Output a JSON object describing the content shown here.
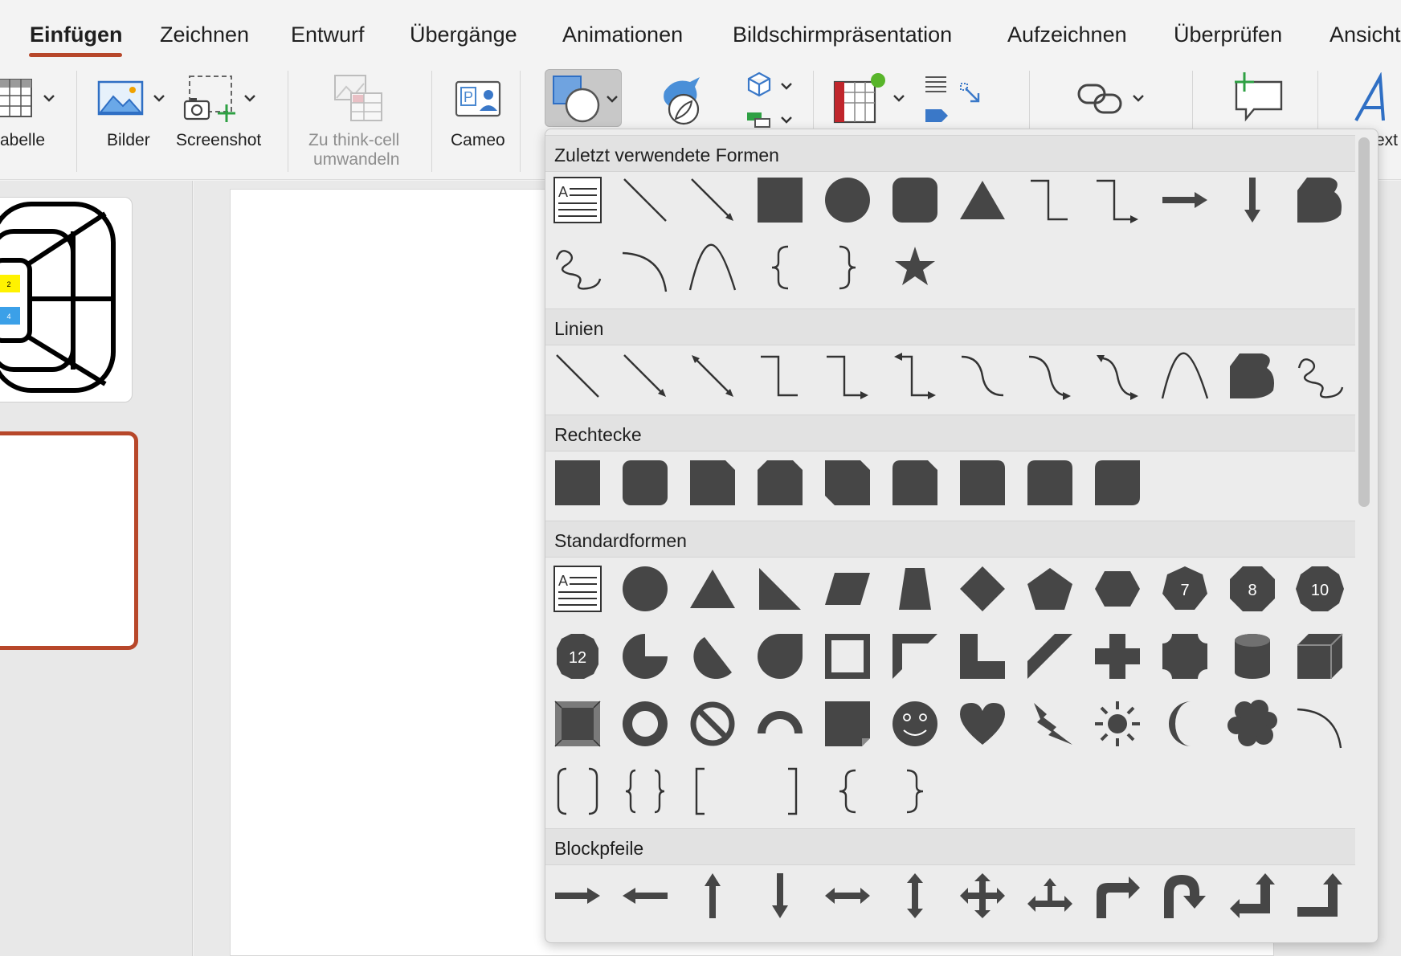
{
  "tabs": [
    "Einfügen",
    "Zeichnen",
    "Entwurf",
    "Übergänge",
    "Animationen",
    "Bildschirmpräsentation",
    "Aufzeichnen",
    "Überprüfen",
    "Ansicht"
  ],
  "ribbon": {
    "table": "abelle",
    "pictures": "Bilder",
    "screenshot": "Screenshot",
    "thinkcell_line1": "Zu think-cell",
    "thinkcell_line2": "umwandeln",
    "cameo": "Cameo",
    "text_partial": "ext"
  },
  "thumbnail": {
    "badge_1": "2",
    "badge_2": "4"
  },
  "dropdown": {
    "sections": [
      "Zuletzt verwendete Formen",
      "Linien",
      "Rechtecke",
      "Standardformen",
      "Blockpfeile"
    ],
    "octagon_numbers": [
      "7",
      "8",
      "10",
      "12"
    ]
  },
  "colors": {
    "accent": "#b7472a",
    "shape_fill": "#464646",
    "badge_yellow": "#fff200",
    "badge_blue": "#3ba0e8"
  }
}
